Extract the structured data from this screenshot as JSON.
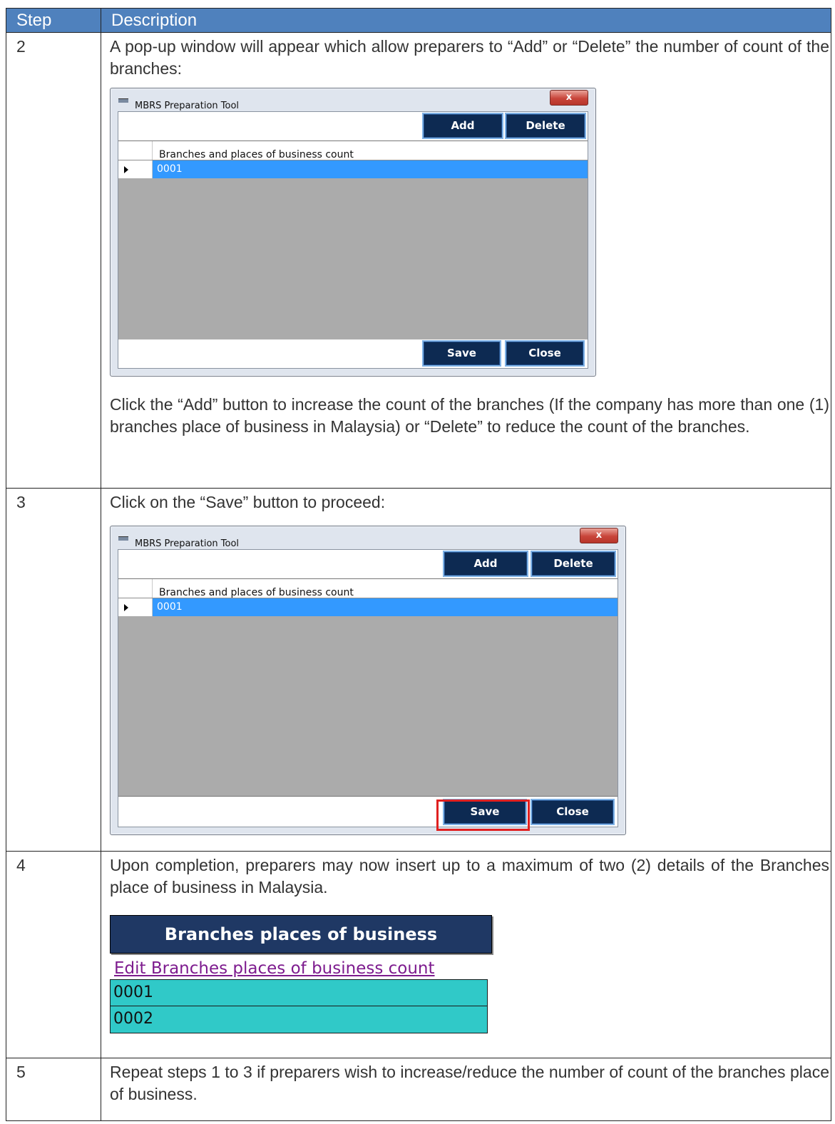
{
  "table": {
    "col_step": "Step",
    "col_description": "Description"
  },
  "rows": [
    {
      "step": "2",
      "text": "A pop-up window will appear which allow preparers to “Add” or “Delete” the number of count of the branches:",
      "text2": "Click the “Add” button to increase the count of the branches (If the company has more than one (1) branches place of business in Malaysia) or “Delete” to reduce the count of the branches."
    },
    {
      "step": "3",
      "text": "Click on the “Save” button to proceed:"
    },
    {
      "step": "4",
      "text": "Upon completion, preparers may now insert up to a maximum of two (2) details of the Branches place of business in Malaysia."
    },
    {
      "step": "5",
      "text": "Repeat steps 1 to 3 if preparers wish to increase/reduce the number of count of the branches place of business."
    }
  ],
  "dialog": {
    "title": "MBRS Preparation Tool",
    "close_glyph": "x",
    "add_label": "Add",
    "delete_label": "Delete",
    "column_header": "Branches and places of business count",
    "row_value": "0001",
    "save_label": "Save",
    "close_label": "Close"
  },
  "web_form": {
    "section_title": "Branches places of business",
    "edit_link": "Edit Branches places of business count",
    "branches": [
      "0001",
      "0002"
    ]
  },
  "colors": {
    "header_blue": "#4f81bd",
    "navy_button": "#0d2a52",
    "selection_blue": "#3399ff",
    "highlight_red": "#e02020",
    "teal_row": "#30c9c8",
    "link_purple": "#7d1b8e"
  }
}
